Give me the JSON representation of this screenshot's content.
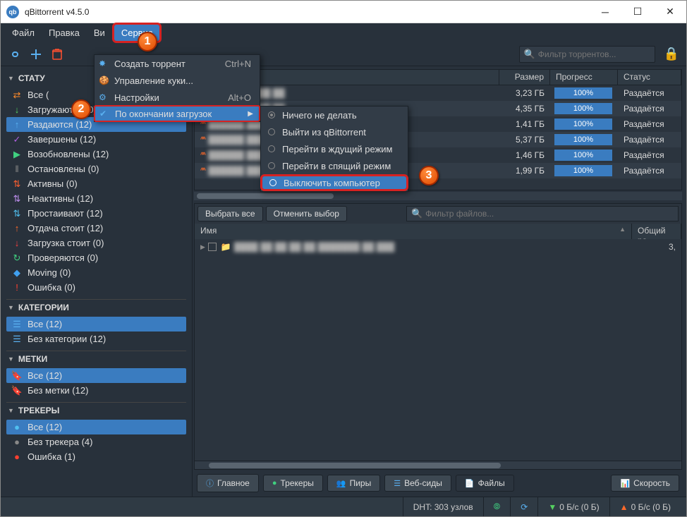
{
  "window": {
    "title": "qBittorrent v4.5.0"
  },
  "menubar": {
    "file": "Файл",
    "edit": "Правка",
    "view": "Ви",
    "tools": "Сервис"
  },
  "toolbar": {
    "search_placeholder": "Фильтр торрентов..."
  },
  "sidebar": {
    "status": {
      "title": "СТАТУ",
      "items": [
        {
          "label": "Все (",
          "icon": "⇄",
          "color": "#ff8a2a"
        },
        {
          "label": "Загружаются (0)",
          "icon": "↓",
          "color": "#55d060"
        },
        {
          "label": "Раздаются (12)",
          "icon": "↑",
          "color": "#5ab0f0",
          "sel": true
        },
        {
          "label": "Завершены (12)",
          "icon": "✓",
          "color": "#b060e0"
        },
        {
          "label": "Возобновлены (12)",
          "icon": "▶",
          "color": "#40d080"
        },
        {
          "label": "Остановлены (0)",
          "icon": "‖",
          "color": "#888"
        },
        {
          "label": "Активны (0)",
          "icon": "⇅",
          "color": "#ff6030"
        },
        {
          "label": "Неактивны (12)",
          "icon": "⇅",
          "color": "#c090f0"
        },
        {
          "label": "Простаивают (12)",
          "icon": "⇅",
          "color": "#50c0f0"
        },
        {
          "label": "Отдача стоит (12)",
          "icon": "↑",
          "color": "#ff6a2a"
        },
        {
          "label": "Загрузка стоит (0)",
          "icon": "↓",
          "color": "#ff4040"
        },
        {
          "label": "Проверяются (0)",
          "icon": "↻",
          "color": "#40d080"
        },
        {
          "label": "Moving (0)",
          "icon": "◆",
          "color": "#40a0f0"
        },
        {
          "label": "Ошибка (0)",
          "icon": "!",
          "color": "#ff4030"
        }
      ]
    },
    "categories": {
      "title": "КАТЕГОРИИ",
      "items": [
        {
          "label": "Все (12)",
          "sel": true
        },
        {
          "label": "Без категории (12)"
        }
      ]
    },
    "tags": {
      "title": "МЕТКИ",
      "items": [
        {
          "label": "Все (12)",
          "sel": true
        },
        {
          "label": "Без метки (12)"
        }
      ]
    },
    "trackers": {
      "title": "ТРЕКЕРЫ",
      "items": [
        {
          "label": "Все (12)",
          "sel": true,
          "color": "#50c0f0"
        },
        {
          "label": "Без трекера (4)",
          "color": "#888"
        },
        {
          "label": "Ошибка (1)",
          "color": "#ff4030"
        }
      ]
    }
  },
  "torrent_cols": {
    "name": "",
    "size": "Размер",
    "progress": "Прогресс",
    "status": "Статус"
  },
  "torrents": [
    {
      "size": "3,23 ГБ",
      "prog": "100%",
      "status": "Раздаётся"
    },
    {
      "size": "4,35 ГБ",
      "prog": "100%",
      "status": "Раздаётся"
    },
    {
      "size": "1,41 ГБ",
      "prog": "100%",
      "status": "Раздаётся"
    },
    {
      "size": "5,37 ГБ",
      "prog": "100%",
      "status": "Раздаётся"
    },
    {
      "size": "1,46 ГБ",
      "prog": "100%",
      "status": "Раздаётся"
    },
    {
      "size": "1,99 ГБ",
      "prog": "100%",
      "status": "Раздаётся"
    }
  ],
  "detail": {
    "select_all": "Выбрать все",
    "deselect": "Отменить выбор",
    "filter_placeholder": "Фильтр файлов...",
    "col_name": "Имя",
    "col_size": "Общий ра",
    "row_size": "3,"
  },
  "tabs": {
    "general": "Главное",
    "trackers": "Трекеры",
    "peers": "Пиры",
    "webseeds": "Веб-сиды",
    "files": "Файлы",
    "speed": "Скорость"
  },
  "statusbar": {
    "dht": "DHT: 303 узлов",
    "dl": "0 Б/с (0 Б)",
    "ul": "0 Б/с (0 Б)"
  },
  "menu1": {
    "create": "Создать торрент",
    "create_sc": "Ctrl+N",
    "cookies": "Управление куки...",
    "settings": "Настройки",
    "settings_sc": "Alt+O",
    "onfinish": "По окончании загрузок"
  },
  "menu2": {
    "nothing": "Ничего не делать",
    "exit": "Выйти из qBittorrent",
    "suspend": "Перейти в ждущий режим",
    "hibernate": "Перейти в спящий режим",
    "shutdown": "Выключить компьютер"
  },
  "callouts": {
    "c1": "1",
    "c2": "2",
    "c3": "3"
  }
}
